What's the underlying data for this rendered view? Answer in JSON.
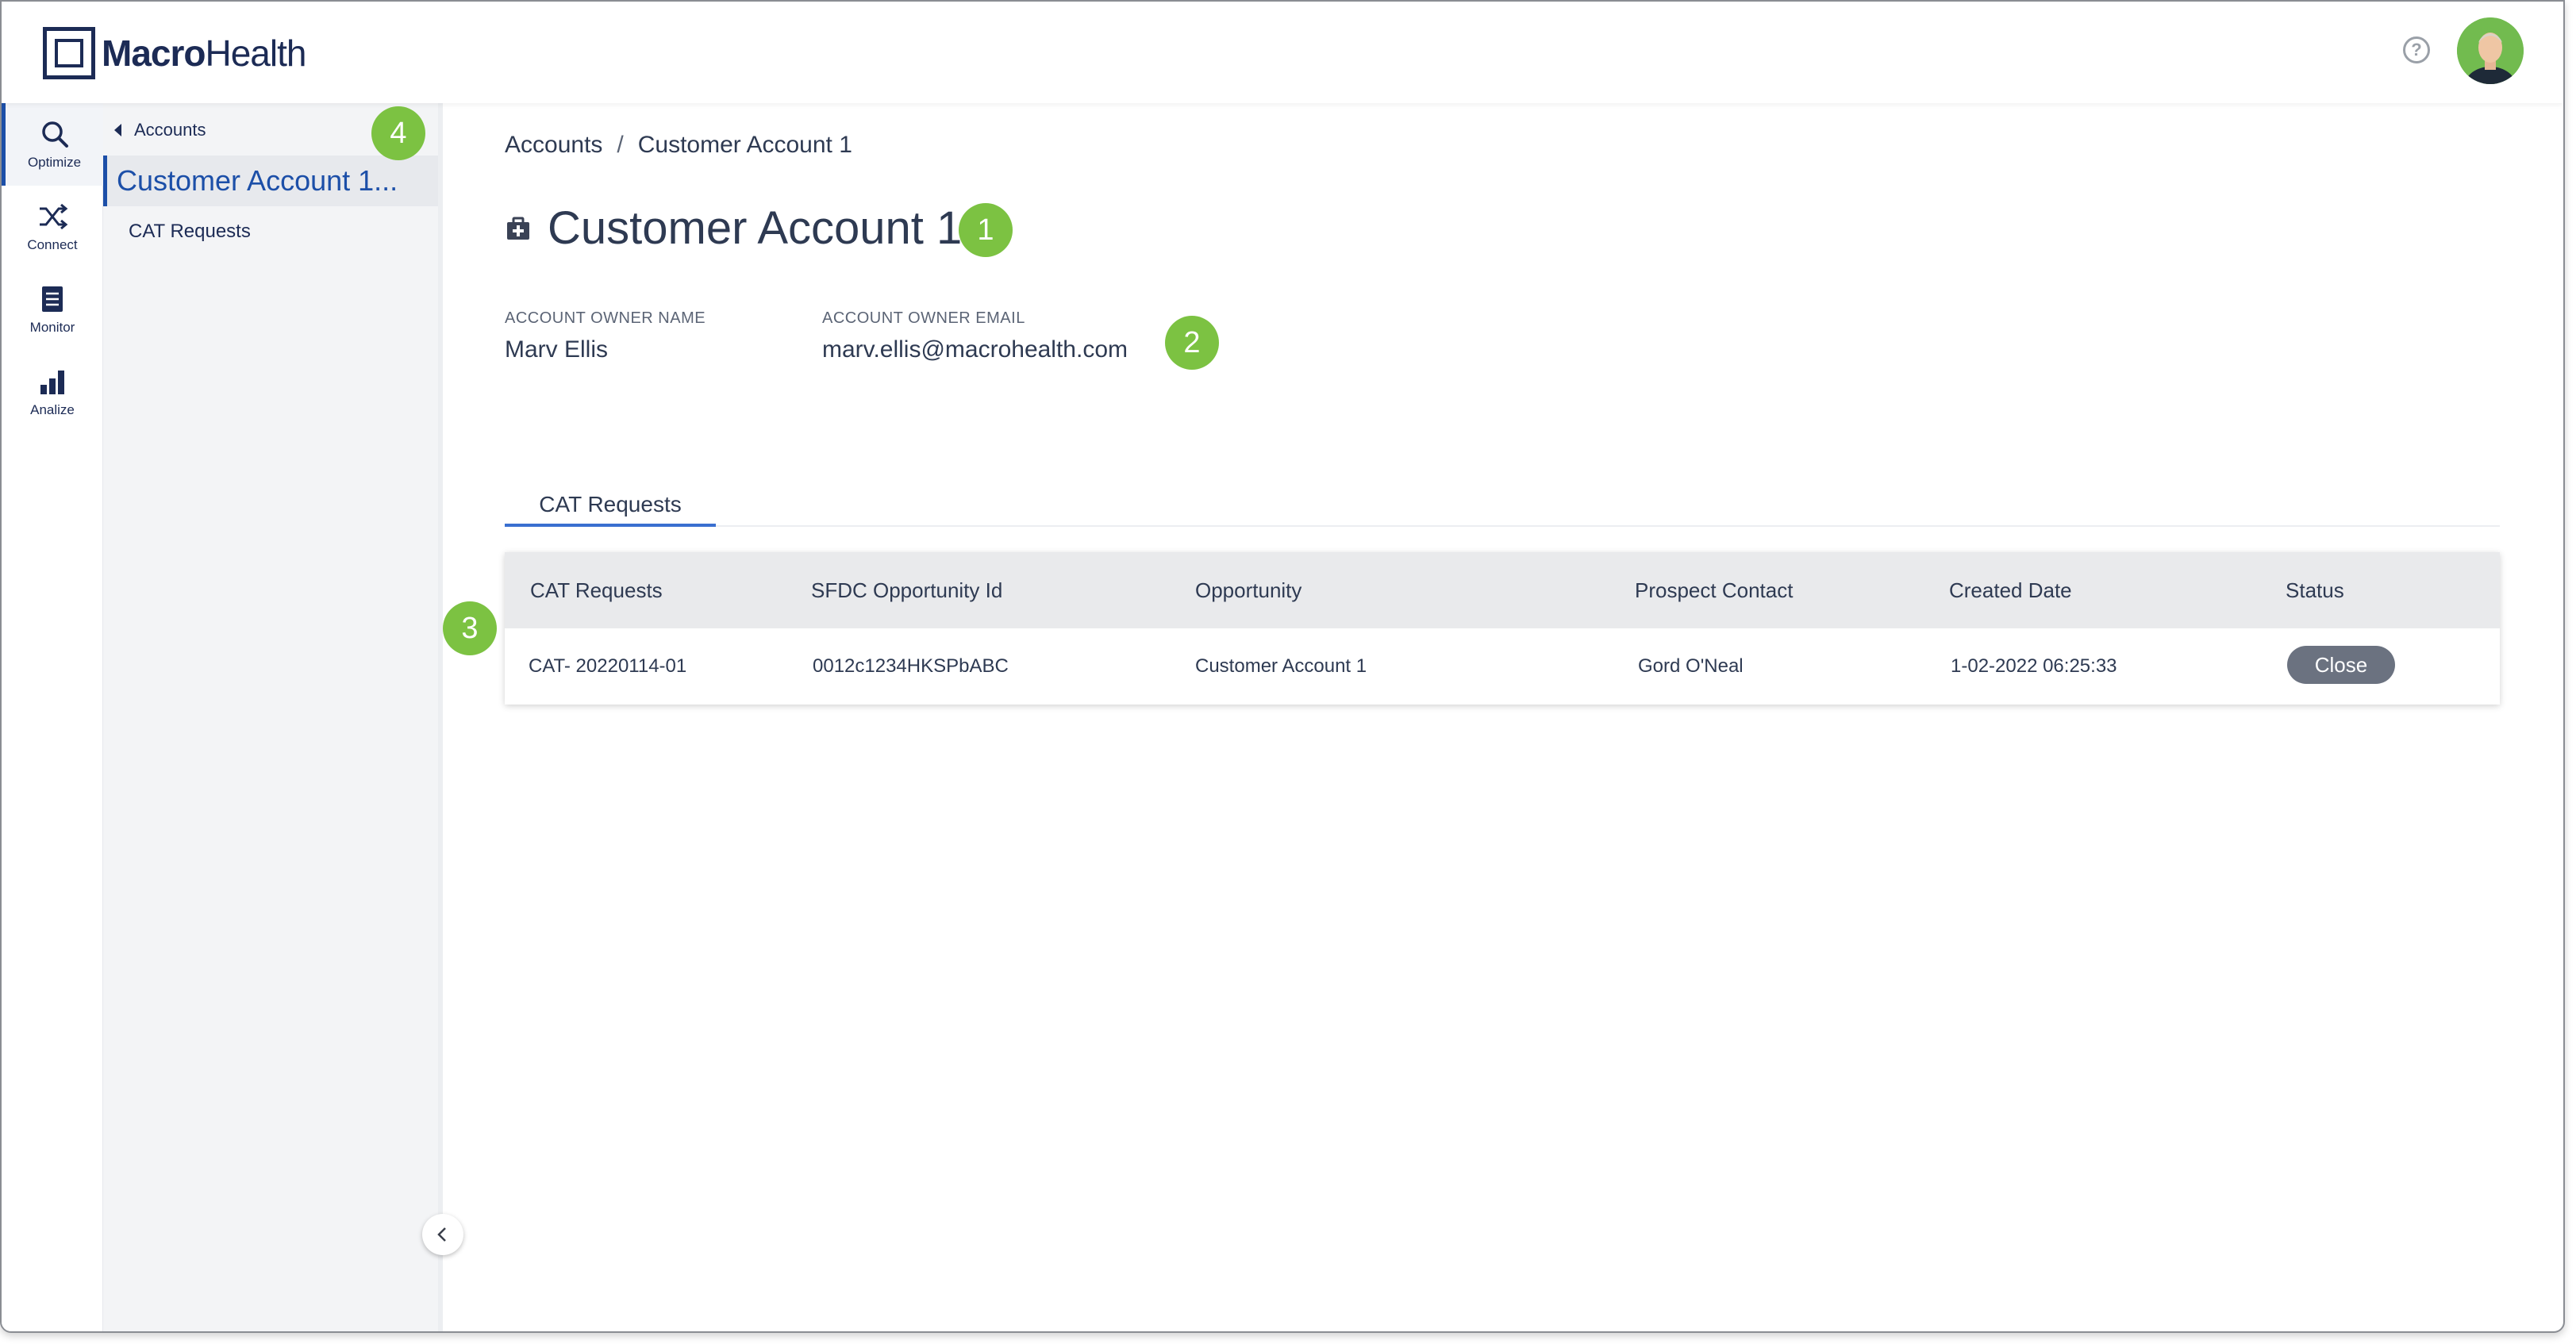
{
  "header": {
    "logo_bold": "Macro",
    "logo_light": "Health",
    "help_glyph": "?"
  },
  "rail": {
    "items": [
      {
        "label": "Optimize",
        "icon": "search-icon",
        "active": true
      },
      {
        "label": "Connect",
        "icon": "shuffle-icon",
        "active": false
      },
      {
        "label": "Monitor",
        "icon": "monitor-icon",
        "active": false
      },
      {
        "label": "Analize",
        "icon": "bar-chart-icon",
        "active": false
      }
    ]
  },
  "subnav": {
    "back_label": "Accounts",
    "current": "Customer Account 1...",
    "links": [
      "CAT Requests"
    ]
  },
  "markers": [
    "1",
    "2",
    "3",
    "4"
  ],
  "main": {
    "breadcrumb": [
      "Accounts",
      "Customer Account 1"
    ],
    "breadcrumb_sep": "/",
    "title": "Customer Account 1",
    "fields": [
      {
        "label": "ACCOUNT OWNER NAME",
        "value": "Marv Ellis"
      },
      {
        "label": "ACCOUNT OWNER EMAIL",
        "value": "marv.ellis@macrohealth.com"
      }
    ],
    "tabs": [
      "CAT Requests"
    ],
    "table": {
      "headers": [
        "CAT Requests",
        "SFDC Opportunity Id",
        "Opportunity",
        "Prospect Contact",
        "Created Date",
        "Status"
      ],
      "rows": [
        [
          "CAT- 20220114-01",
          "0012c1234HKSPbABC",
          "Customer Account 1",
          "Gord O'Neal",
          "1-02-2022 06:25:33",
          "Close"
        ]
      ]
    }
  },
  "colors": {
    "brand": "#1c2b55",
    "accent": "#1c4fa8",
    "marker": "#7cc242",
    "status_pill": "#6b7280"
  }
}
